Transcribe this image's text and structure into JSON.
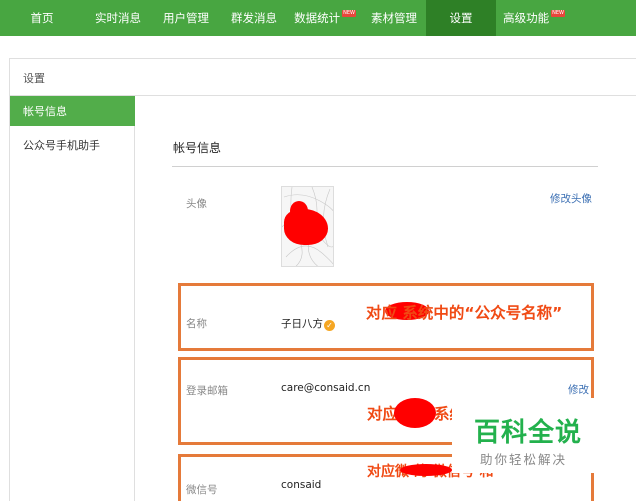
{
  "topnav": {
    "items": [
      {
        "label": "首页"
      },
      {
        "label": "实时消息"
      },
      {
        "label": "用户管理"
      },
      {
        "label": "群发消息"
      },
      {
        "label": "数据统计"
      },
      {
        "label": "素材管理"
      },
      {
        "label": "设置"
      },
      {
        "label": "高级功能"
      }
    ],
    "new_badge": "NEW",
    "active_index": 6
  },
  "breadcrumb": {
    "label": "设置"
  },
  "sidebar": {
    "items": [
      {
        "label": "帐号信息",
        "active": true
      },
      {
        "label": "公众号手机助手",
        "active": false
      }
    ]
  },
  "main": {
    "section_title": "帐号信息",
    "rows": {
      "avatar": {
        "label": "头像",
        "action": "修改头像"
      },
      "name": {
        "label": "名称",
        "value": "子日八方"
      },
      "email": {
        "label": "登录邮箱",
        "value": "care@consaid.cn",
        "action": "修改"
      },
      "wechat_id": {
        "label": "微信号",
        "value": "consaid"
      }
    }
  },
  "annotations": {
    "name_note": "对应 系统中的“公众号名称”",
    "email_note_a": "对应",
    "email_note_b": "系统",
    "wechat_note": "对应微 的 微信号 和"
  },
  "watermark": {
    "title": "百科全说",
    "subtitle": "助你轻松解决"
  },
  "colors": {
    "nav_green": "#48a641",
    "nav_active": "#2e8026",
    "sidebar_active": "#52ad4a",
    "highlight_box": "#e57a3a",
    "annotation_text": "#f04a14",
    "link_blue": "#3b6fb3",
    "watermark_green": "#23b14d"
  }
}
